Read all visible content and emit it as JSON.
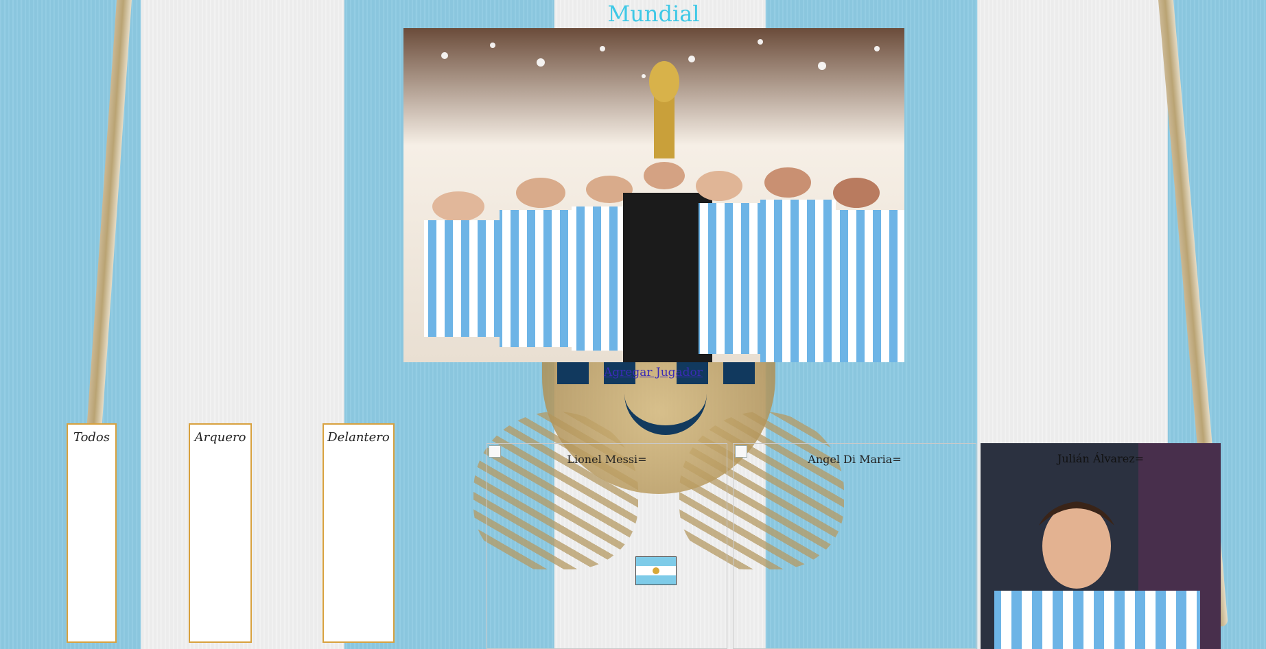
{
  "page": {
    "title": "Mundial"
  },
  "hero": {
    "alt": "Argentina celebra el título mundial"
  },
  "actions": {
    "add_player": "Agregar Jugador"
  },
  "filters": [
    {
      "label": "Todos"
    },
    {
      "label": "Arquero"
    },
    {
      "label": "Delantero"
    }
  ],
  "players": [
    {
      "name": "Lionel Messi="
    },
    {
      "name": "Angel Di Maria="
    },
    {
      "name": "Julián Álvarez="
    }
  ],
  "colors": {
    "title": "#3ec8e6",
    "sky_blue": "#8dcae2",
    "white_stripe": "#f1f1f1",
    "accent_border": "#d8a13e",
    "link": "#3a2bb5"
  },
  "icons": {
    "flag": "argentina-flag-icon",
    "broken_image": "broken-image-icon"
  }
}
